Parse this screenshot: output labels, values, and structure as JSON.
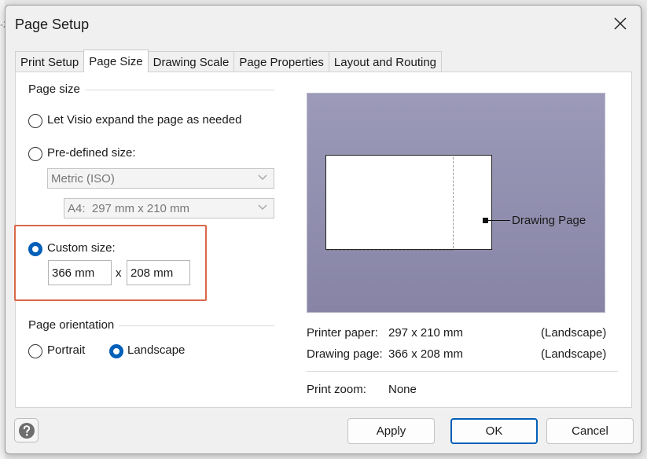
{
  "dialog": {
    "title": "Page Setup",
    "tabs": [
      {
        "label": "Print Setup"
      },
      {
        "label": "Page Size"
      },
      {
        "label": "Drawing Scale"
      },
      {
        "label": "Page Properties"
      },
      {
        "label": "Layout and Routing"
      }
    ],
    "active_tab": "Page Size"
  },
  "page_size": {
    "group_label": "Page size",
    "option_expand": "Let Visio expand the page as needed",
    "option_predefined": "Pre-defined size:",
    "predefined_standard": "Metric (ISO)",
    "predefined_size": "A4:  297 mm x 210 mm",
    "option_custom": "Custom size:",
    "custom_width": "366 mm",
    "custom_separator": "x",
    "custom_height": "208 mm",
    "selected": "custom"
  },
  "orientation": {
    "group_label": "Page orientation",
    "portrait": "Portrait",
    "landscape": "Landscape",
    "selected": "landscape"
  },
  "preview": {
    "pointer_label": "Drawing Page",
    "background_color": "#9390b0"
  },
  "info": {
    "printer_paper_label": "Printer paper:",
    "printer_paper_value": "297 x 210 mm",
    "printer_paper_orientation": "(Landscape)",
    "drawing_page_label": "Drawing page:",
    "drawing_page_value": "366 x 208 mm",
    "drawing_page_orientation": "(Landscape)",
    "print_zoom_label": "Print zoom:",
    "print_zoom_value": "None"
  },
  "buttons": {
    "apply": "Apply",
    "ok": "OK",
    "cancel": "Cancel"
  },
  "colors": {
    "accent": "#005fb8",
    "highlight": "#d9694a"
  },
  "background": {
    "fragment": "-2"
  }
}
